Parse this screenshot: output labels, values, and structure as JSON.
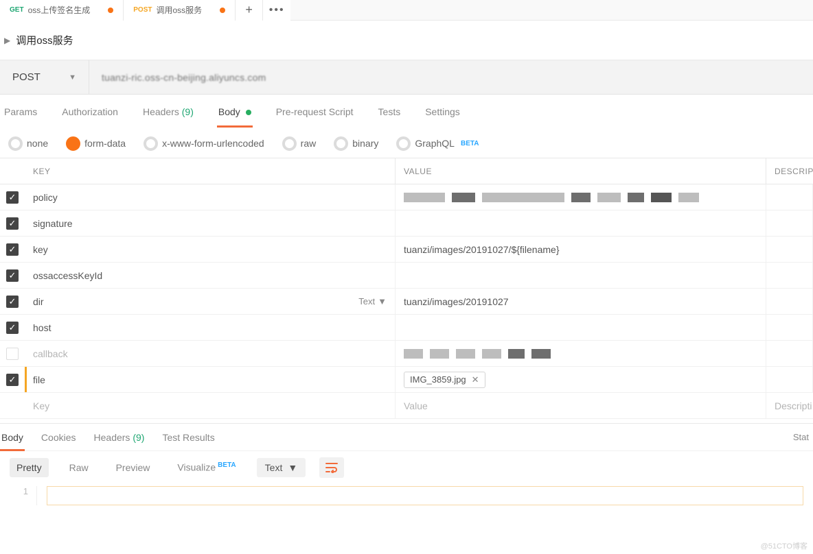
{
  "tabs": [
    {
      "method": "GET",
      "label": "oss上传签名生成",
      "dirty": true
    },
    {
      "method": "POST",
      "label": "调用oss服务",
      "dirty": true
    }
  ],
  "title": "调用oss服务",
  "request": {
    "method": "POST",
    "url": "tuanzi-ric.oss-cn-beijing.aliyuncs.com"
  },
  "reqTabs": {
    "params": "Params",
    "auth": "Authorization",
    "headers": "Headers",
    "headersCount": "(9)",
    "body": "Body",
    "prereq": "Pre-request Script",
    "tests": "Tests",
    "settings": "Settings"
  },
  "bodyTypes": {
    "none": "none",
    "formData": "form-data",
    "urlencoded": "x-www-form-urlencoded",
    "raw": "raw",
    "binary": "binary",
    "graphql": "GraphQL",
    "beta": "BETA"
  },
  "kvHead": {
    "key": "KEY",
    "value": "VALUE",
    "desc": "DESCRIPTI"
  },
  "kvRows": [
    {
      "checked": true,
      "key": "policy",
      "value": ""
    },
    {
      "checked": true,
      "key": "signature",
      "value": ""
    },
    {
      "checked": true,
      "key": "key",
      "value": "tuanzi/images/20191027/${filename}"
    },
    {
      "checked": true,
      "key": "ossaccessKeyId",
      "value": ""
    },
    {
      "checked": true,
      "key": "dir",
      "value": "tuanzi/images/20191027",
      "typeLabel": "Text"
    },
    {
      "checked": true,
      "key": "host",
      "value": ""
    },
    {
      "checked": false,
      "key": "callback",
      "value": ""
    },
    {
      "checked": true,
      "key": "file",
      "file": "IMG_3859.jpg"
    }
  ],
  "kvPlaceholder": {
    "key": "Key",
    "value": "Value",
    "desc": "Descripti"
  },
  "respTabs": {
    "body": "Body",
    "cookies": "Cookies",
    "headers": "Headers",
    "headersCount": "(9)",
    "tests": "Test Results",
    "status": "Stat"
  },
  "respModes": {
    "pretty": "Pretty",
    "raw": "Raw",
    "preview": "Preview",
    "visualize": "Visualize",
    "beta": "BETA",
    "lang": "Text"
  },
  "lineNo": "1",
  "watermark": "@51CTO博客"
}
